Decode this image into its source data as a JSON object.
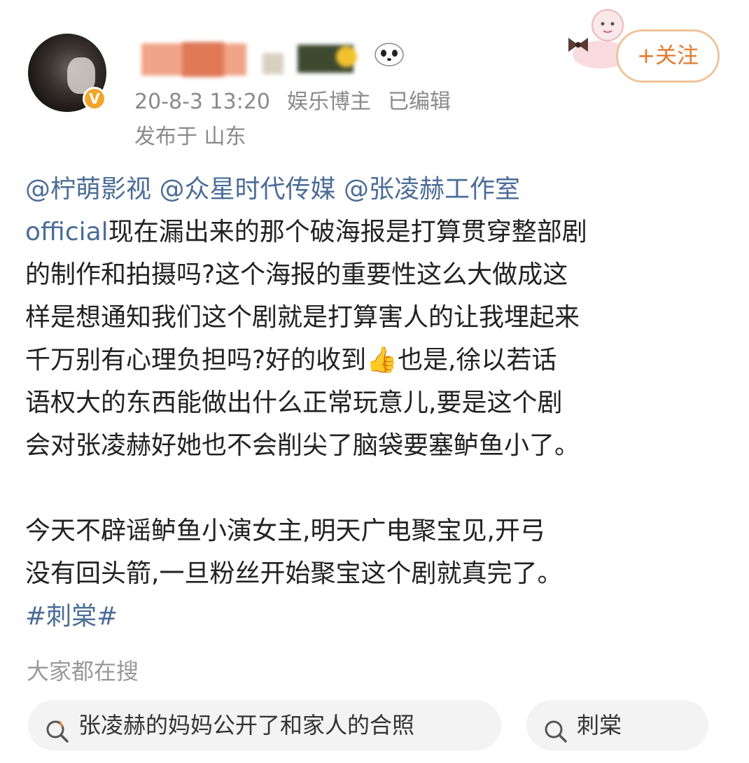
{
  "post": {
    "verified_badge": "V",
    "meta": {
      "time": "20-8-3 13:20",
      "role": "娱乐博主",
      "edited": "已编辑",
      "location": "发布于 山东"
    },
    "follow_label": "+关注",
    "lines": [
      {
        "mention1": "@柠萌影视",
        "mention2": "@众星时代传媒",
        "mention3": "@张凌赫工作室"
      },
      {
        "mention": "official",
        "text": "现在漏出来的那个破海报是打算贯穿整部剧"
      },
      {
        "text": "的制作和拍摄吗?这个海报的重要性这么大做成这"
      },
      {
        "text": "样是想通知我们这个剧就是打算害人的让我埋起来"
      },
      {
        "text1": "千万别有心理负担吗?好的收到",
        "emoji": "👍",
        "text2": "也是,徐以若话"
      },
      {
        "text": "语权大的东西能做出什么正常玩意儿,要是这个剧"
      },
      {
        "text": "会对张凌赫好她也不会削尖了脑袋要塞鲈鱼小了。"
      },
      {
        "text": "今天不辟谣鲈鱼小演女主,明天广电聚宝见,开弓"
      },
      {
        "text": "没有回头箭,一旦粉丝开始聚宝这个剧就真完了。"
      }
    ],
    "topic": "#刺棠#"
  },
  "search": {
    "title": "大家都在搜",
    "chips": [
      {
        "label": "张凌赫的妈妈公开了和家人的合照",
        "icon": "hot-search-icon"
      },
      {
        "label": "刺棠",
        "icon": "search-icon"
      }
    ]
  },
  "colors": {
    "mention": "#4b6d97",
    "follow": "#e07a2c",
    "badge": "#f2a52b",
    "meta": "#8a8a8a"
  }
}
